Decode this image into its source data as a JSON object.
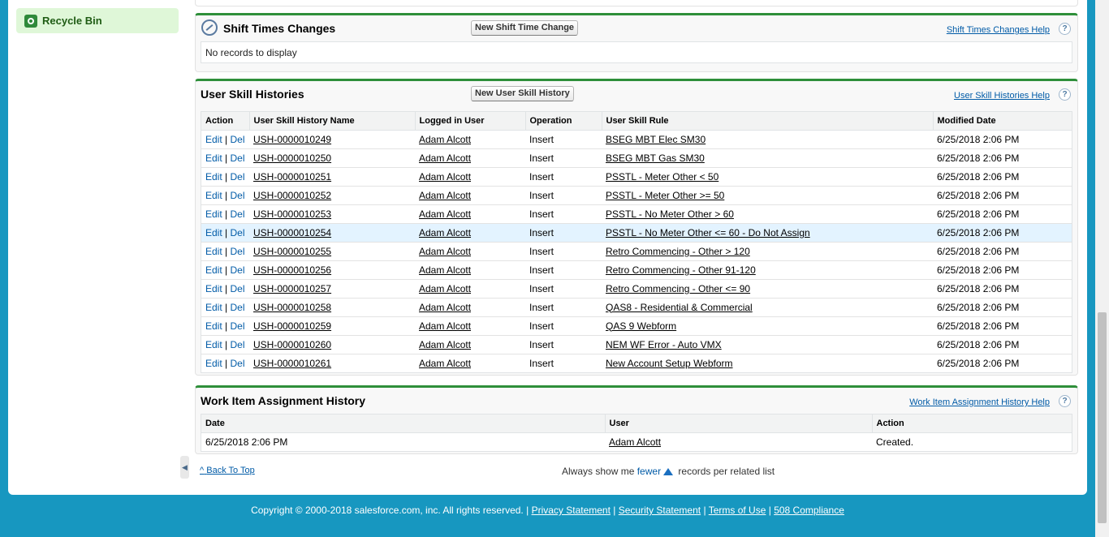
{
  "sidebar": {
    "recycle_bin_label": "Recycle Bin"
  },
  "shift_times": {
    "title": "Shift Times Changes",
    "new_button": "New Shift Time Change",
    "help_link": "Shift Times Changes Help",
    "empty_text": "No records to display"
  },
  "user_skill": {
    "title": "User Skill Histories",
    "new_button": "New User Skill History",
    "help_link": "User Skill Histories Help",
    "columns": [
      "Action",
      "User Skill History Name",
      "Logged in User",
      "Operation",
      "User Skill Rule",
      "Modified Date"
    ],
    "edit_label": "Edit",
    "del_label": "Del",
    "rows": [
      {
        "name": "USH-0000010249",
        "user": "Adam Alcott",
        "operation": "Insert",
        "rule": "BSEG MBT Elec SM30",
        "date": "6/25/2018 2:06 PM"
      },
      {
        "name": "USH-0000010250",
        "user": "Adam Alcott",
        "operation": "Insert",
        "rule": "BSEG MBT Gas SM30",
        "date": "6/25/2018 2:06 PM"
      },
      {
        "name": "USH-0000010251",
        "user": "Adam Alcott",
        "operation": "Insert",
        "rule": "PSSTL - Meter Other < 50",
        "date": "6/25/2018 2:06 PM"
      },
      {
        "name": "USH-0000010252",
        "user": "Adam Alcott",
        "operation": "Insert",
        "rule": "PSSTL - Meter Other >= 50",
        "date": "6/25/2018 2:06 PM"
      },
      {
        "name": "USH-0000010253",
        "user": "Adam Alcott",
        "operation": "Insert",
        "rule": "PSSTL - No Meter Other > 60",
        "date": "6/25/2018 2:06 PM"
      },
      {
        "name": "USH-0000010254",
        "user": "Adam Alcott",
        "operation": "Insert",
        "rule": "PSSTL - No Meter Other <= 60 - Do Not Assign",
        "date": "6/25/2018 2:06 PM"
      },
      {
        "name": "USH-0000010255",
        "user": "Adam Alcott",
        "operation": "Insert",
        "rule": "Retro Commencing - Other > 120",
        "date": "6/25/2018 2:06 PM"
      },
      {
        "name": "USH-0000010256",
        "user": "Adam Alcott",
        "operation": "Insert",
        "rule": "Retro Commencing - Other 91-120",
        "date": "6/25/2018 2:06 PM"
      },
      {
        "name": "USH-0000010257",
        "user": "Adam Alcott",
        "operation": "Insert",
        "rule": "Retro Commencing - Other <= 90",
        "date": "6/25/2018 2:06 PM"
      },
      {
        "name": "USH-0000010258",
        "user": "Adam Alcott",
        "operation": "Insert",
        "rule": "QAS8 - Residential & Commercial",
        "date": "6/25/2018 2:06 PM"
      },
      {
        "name": "USH-0000010259",
        "user": "Adam Alcott",
        "operation": "Insert",
        "rule": "QAS 9 Webform",
        "date": "6/25/2018 2:06 PM"
      },
      {
        "name": "USH-0000010260",
        "user": "Adam Alcott",
        "operation": "Insert",
        "rule": "NEM WF Error - Auto VMX",
        "date": "6/25/2018 2:06 PM"
      },
      {
        "name": "USH-0000010261",
        "user": "Adam Alcott",
        "operation": "Insert",
        "rule": "New Account Setup Webform",
        "date": "6/25/2018 2:06 PM"
      }
    ]
  },
  "work_item": {
    "title": "Work Item Assignment History",
    "help_link": "Work Item Assignment History Help",
    "columns": [
      "Date",
      "User",
      "Action"
    ],
    "rows": [
      {
        "date": "6/25/2018 2:06 PM",
        "user": "Adam Alcott",
        "action": "Created."
      }
    ]
  },
  "footer_nav": {
    "back_to_top": "Back To Top",
    "always_show": "Always show me",
    "fewer": "fewer",
    "records_per": "records per related list"
  },
  "legal": {
    "copyright": "Copyright © 2000-2018 salesforce.com, inc. All rights reserved. |",
    "privacy": "Privacy Statement",
    "security": "Security Statement",
    "terms": "Terms of Use",
    "compliance": "508 Compliance"
  },
  "ui": {
    "help_glyph": "?"
  }
}
